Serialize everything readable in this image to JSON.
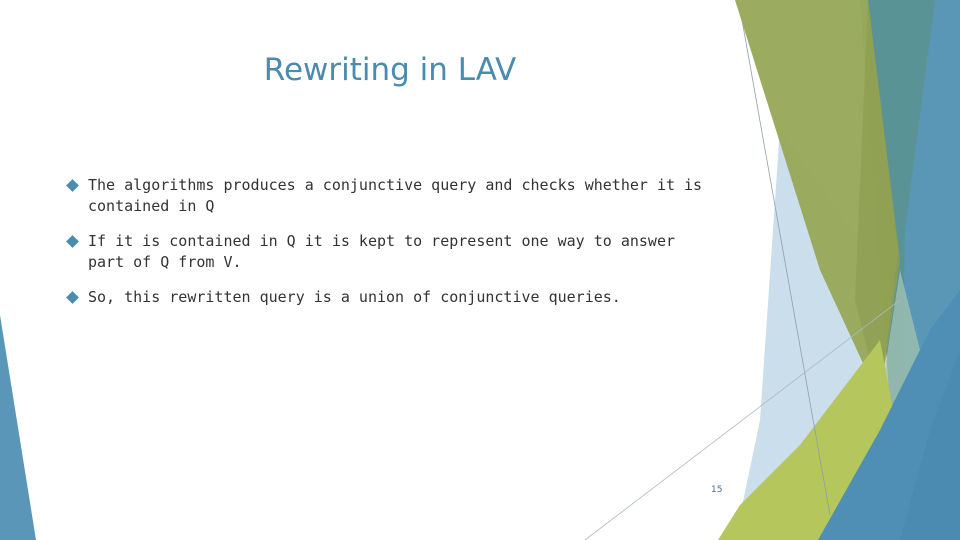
{
  "slide": {
    "title": "Rewriting in LAV",
    "bullets": [
      {
        "text": "The algorithms produces a conjunctive query and checks whether it is contained in Q"
      },
      {
        "text": "If it is contained in Q it is kept to represent one way to answer part of Q from V."
      },
      {
        "text": "So, this rewritten query is a union of conjunctive queries."
      }
    ],
    "slide_number": "15"
  },
  "theme": {
    "accent_blue": "#4a8bb0",
    "accent_green": "#9aab5a",
    "lime": "#b2c45c",
    "light_blue": "#c2d9e8",
    "text": "#333333"
  }
}
